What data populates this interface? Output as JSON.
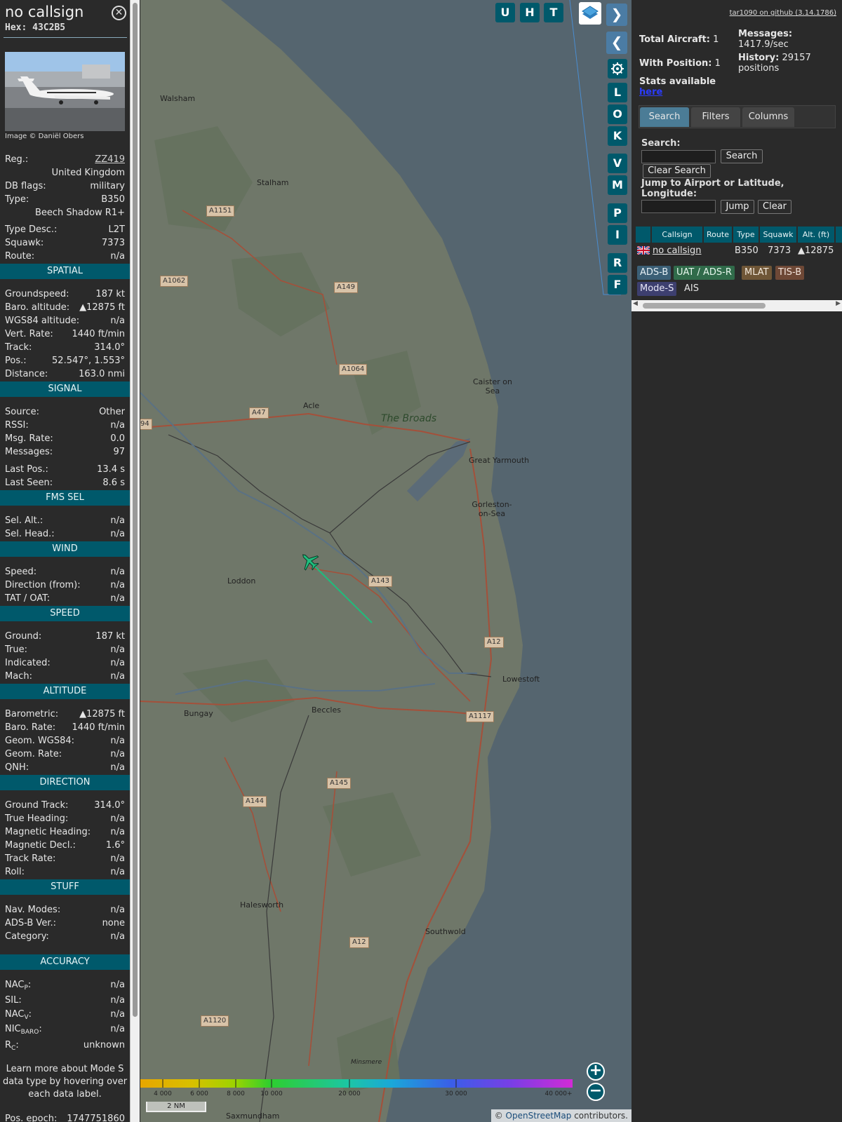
{
  "aircraft": {
    "callsign": "no callsign",
    "hex_line": "Hex: 43C2B5",
    "image_credit": "Image © Daniël Obers",
    "close_icon": "close-icon"
  },
  "details": [
    {
      "label": "Reg.:",
      "value": "ZZ419",
      "link": true
    },
    {
      "label": "",
      "value": "United Kingdom"
    },
    {
      "label": "DB flags:",
      "value": "military"
    },
    {
      "label": "Type:",
      "value": "B350"
    },
    {
      "label": "",
      "value": "Beech Shadow R1+"
    },
    {
      "label": "Type Desc.:",
      "value": "L2T"
    },
    {
      "label": "Squawk:",
      "value": "7373"
    },
    {
      "label": "Route:",
      "value": "n/a"
    }
  ],
  "sections": {
    "spatial": {
      "title": "SPATIAL",
      "rows": [
        {
          "label": "Groundspeed:",
          "value": "187 kt"
        },
        {
          "label": "Baro. altitude:",
          "value": "▲12875 ft"
        },
        {
          "label": "WGS84 altitude:",
          "value": "n/a"
        },
        {
          "label": "Vert. Rate:",
          "value": "1440 ft/min"
        },
        {
          "label": "Track:",
          "value": "314.0°"
        },
        {
          "label": "Pos.:",
          "value": "52.547°, 1.553°"
        },
        {
          "label": "Distance:",
          "value": "163.0 nmi"
        }
      ]
    },
    "signal": {
      "title": "SIGNAL",
      "rows": [
        {
          "label": "Source:",
          "value": "Other"
        },
        {
          "label": "RSSI:",
          "value": "n/a"
        },
        {
          "label": "Msg. Rate:",
          "value": "0.0"
        },
        {
          "label": "Messages:",
          "value": "97"
        },
        {
          "label": "Last Pos.:",
          "value": "13.4 s"
        },
        {
          "label": "Last Seen:",
          "value": "8.6 s"
        }
      ]
    },
    "fms": {
      "title": "FMS SEL",
      "rows": [
        {
          "label": "Sel. Alt.:",
          "value": "n/a"
        },
        {
          "label": "Sel. Head.:",
          "value": "n/a"
        }
      ]
    },
    "wind": {
      "title": "WIND",
      "rows": [
        {
          "label": "Speed:",
          "value": "n/a"
        },
        {
          "label": "Direction (from):",
          "value": "n/a"
        },
        {
          "label": "TAT / OAT:",
          "value": "n/a"
        }
      ]
    },
    "speed": {
      "title": "SPEED",
      "rows": [
        {
          "label": "Ground:",
          "value": "187 kt"
        },
        {
          "label": "True:",
          "value": "n/a"
        },
        {
          "label": "Indicated:",
          "value": "n/a"
        },
        {
          "label": "Mach:",
          "value": "n/a"
        }
      ]
    },
    "altitude": {
      "title": "ALTITUDE",
      "rows": [
        {
          "label": "Barometric:",
          "value": "▲12875 ft"
        },
        {
          "label": "Baro. Rate:",
          "value": "1440 ft/min"
        },
        {
          "label": "Geom. WGS84:",
          "value": "n/a"
        },
        {
          "label": "Geom. Rate:",
          "value": "n/a"
        },
        {
          "label": "QNH:",
          "value": "n/a"
        }
      ]
    },
    "direction": {
      "title": "DIRECTION",
      "rows": [
        {
          "label": "Ground Track:",
          "value": "314.0°"
        },
        {
          "label": "True Heading:",
          "value": "n/a"
        },
        {
          "label": "Magnetic Heading:",
          "value": "n/a"
        },
        {
          "label": "Magnetic Decl.:",
          "value": "1.6°"
        },
        {
          "label": "Track Rate:",
          "value": "n/a"
        },
        {
          "label": "Roll:",
          "value": "n/a"
        }
      ]
    },
    "stuff": {
      "title": "STUFF",
      "rows": [
        {
          "label": "Nav. Modes:",
          "value": "n/a"
        },
        {
          "label": "ADS-B Ver.:",
          "value": "none"
        },
        {
          "label": "Category:",
          "value": "n/a"
        }
      ]
    },
    "accuracy": {
      "title": "ACCURACY",
      "rows": [
        {
          "label_main": "NAC",
          "label_sub": "P",
          "value": "n/a"
        },
        {
          "label_main": "SIL",
          "label_sub": "",
          "value": "n/a"
        },
        {
          "label_main": "NAC",
          "label_sub": "V",
          "value": "n/a"
        },
        {
          "label_main": "NIC",
          "label_sub": "BARO",
          "value": "n/a"
        },
        {
          "label_main": "R",
          "label_sub": "C",
          "value": "unknown"
        }
      ]
    }
  },
  "learn_more": "Learn more about Mode S data type by hovering over each data label.",
  "pos_epoch": {
    "label": "Pos. epoch:",
    "value": "1747751860"
  },
  "map": {
    "towns": [
      "Walsham",
      "Stalham",
      "Acle",
      "Caister on Sea",
      "Great Yarmouth",
      "Gorleston-on-Sea",
      "Loddon",
      "Lowestoft",
      "Bungay",
      "Beccles",
      "Halesworth",
      "Southwold",
      "Saxmundham",
      "Minsmere"
    ],
    "roads": [
      "A1151",
      "A1062",
      "A149",
      "A1064",
      "A47",
      "94",
      "A143",
      "A12",
      "A1117",
      "A145",
      "A144",
      "A12",
      "A1120"
    ],
    "region": "The Broads",
    "toolbar_letters": [
      "U",
      "H",
      "T"
    ],
    "side_letters": [
      "L",
      "O",
      "K",
      "V",
      "M",
      "P",
      "I",
      "R",
      "F"
    ],
    "altitude_labels": [
      "4 000",
      "6 000",
      "8 000",
      "10 000",
      "20 000",
      "30 000",
      "40 000+"
    ],
    "scale": "2 NM",
    "attribution_prefix": "©",
    "attribution_link": "OpenStreetMap",
    "attribution_suffix": "contributors."
  },
  "sidebar": {
    "github": "tar1090 on github (3.14.1786)",
    "total_aircraft_label": "Total Aircraft:",
    "total_aircraft": "1",
    "with_position_label": "With Position:",
    "with_position": "1",
    "messages_label": "Messages:",
    "messages_value": "1417.9/sec",
    "history_label": "History:",
    "history_value": "29157",
    "history_unit": "positions",
    "stats_text": "Stats available",
    "stats_link": "here",
    "tabs": [
      "Search",
      "Filters",
      "Columns"
    ],
    "search_label": "Search:",
    "search_button": "Search",
    "clear_search_button": "Clear Search",
    "jump_label": "Jump to Airport or Latitude, Longitude:",
    "jump_button": "Jump",
    "clear_button": "Clear",
    "table_headers": [
      "Callsign",
      "Route",
      "Type",
      "Squawk",
      "Alt. (ft)"
    ],
    "table_row": {
      "callsign": "no callsign",
      "route": "",
      "type": "B350",
      "squawk": "7373",
      "alt": "▲12875"
    },
    "source_chips": [
      "ADS-B",
      "UAT / ADS-R",
      "MLAT",
      "TIS-B",
      "Mode-S",
      "AIS"
    ]
  },
  "colors": {
    "section": "#00596b",
    "aircraft": "#1fbd7d",
    "chip_adsb": "#3b5f76",
    "chip_uat": "#306b4a",
    "chip_mlat": "#6f5637",
    "chip_tisb": "#6e4836",
    "chip_modes": "#3d3f6f"
  }
}
